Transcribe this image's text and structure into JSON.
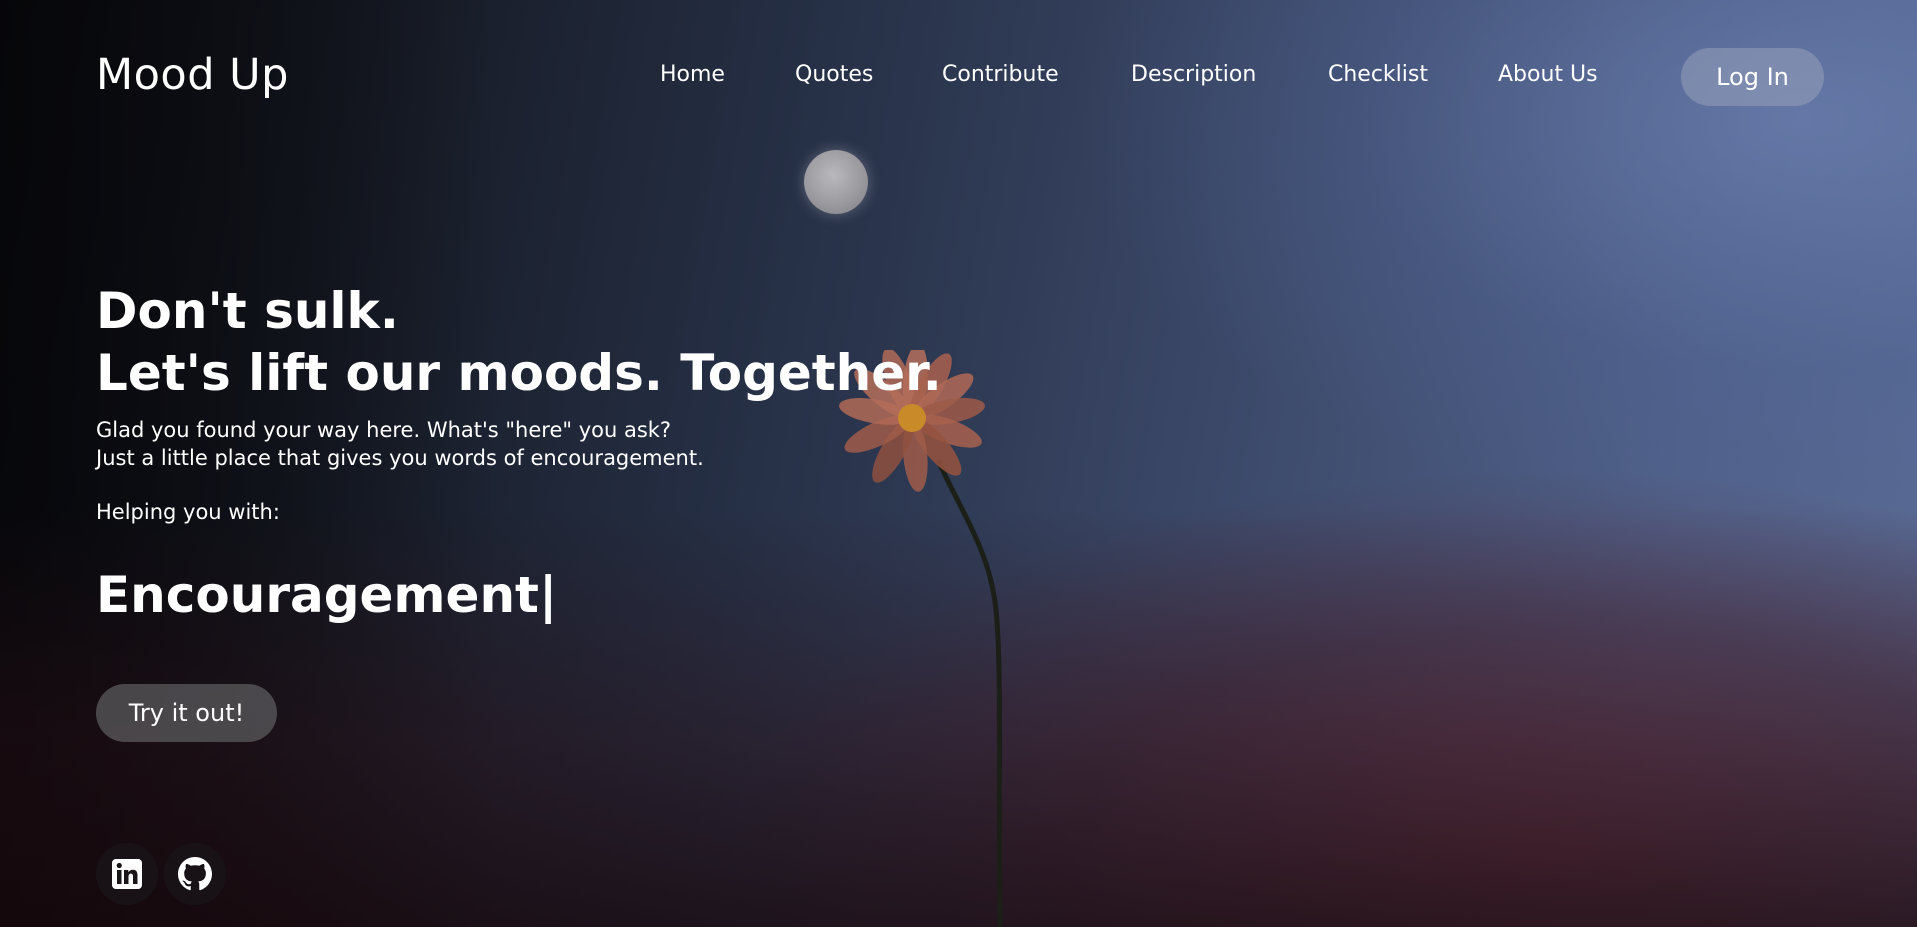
{
  "header": {
    "brand": "Mood Up",
    "nav": [
      "Home",
      "Quotes",
      "Contribute",
      "Description",
      "Checklist",
      "About Us"
    ],
    "login_label": "Log In"
  },
  "hero": {
    "title_line1": "Don't sulk.",
    "title_line2": "Let's lift our moods. Together.",
    "sub_line1": "Glad you found your way here. What's \"here\" you ask?",
    "sub_line2": "Just a little place that gives you words of encouragement.",
    "helping_label": "Helping you with:",
    "typed_word": "Encouragement|",
    "cta_label": "Try it out!"
  },
  "social": {
    "icons": [
      "linkedin-icon",
      "github-icon"
    ]
  },
  "colors": {
    "login_bg": "#8b94ad",
    "cta_bg": "#5f5f62",
    "text": "#ffffff"
  }
}
